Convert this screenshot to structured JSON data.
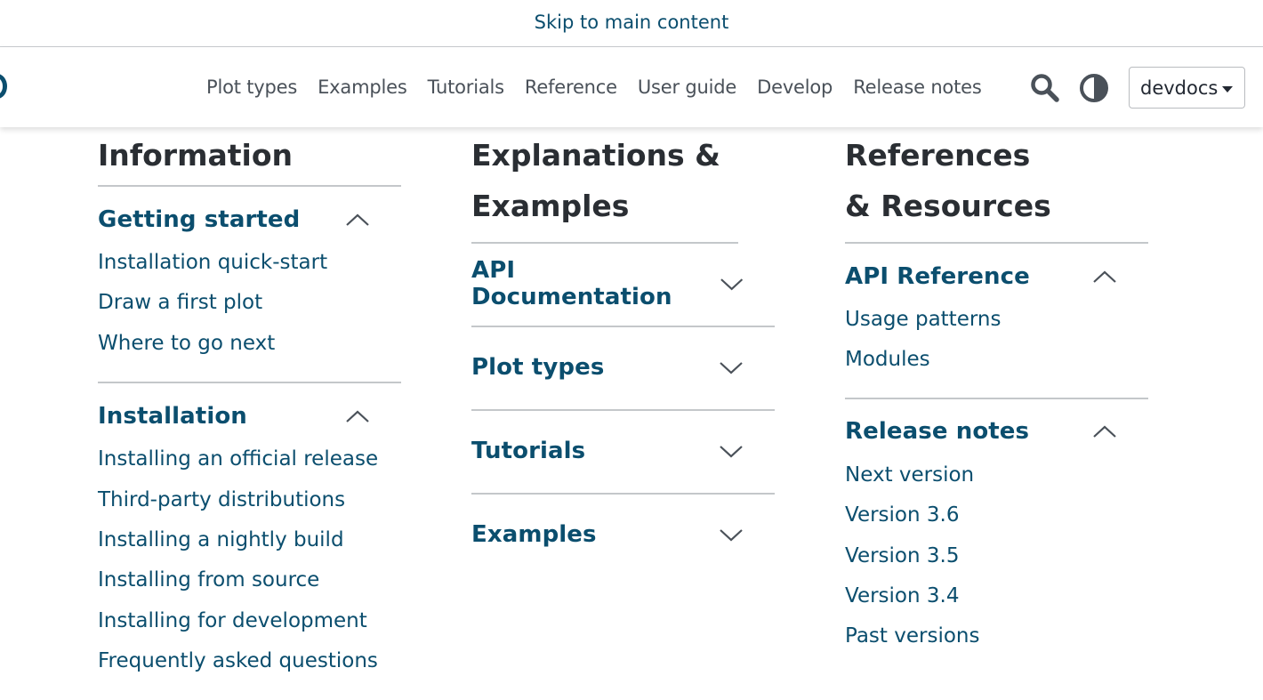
{
  "skip_link": "Skip to main content",
  "nav": {
    "links": [
      "Plot types",
      "Examples",
      "Tutorials",
      "Reference",
      "User guide",
      "Develop",
      "Release notes"
    ],
    "search_icon": "search-icon",
    "theme_icon": "theme-toggle-icon",
    "version": "devdocs"
  },
  "colors": {
    "link": "#0b4e6e",
    "heading": "#2a2e33",
    "nav": "#4a5159"
  },
  "columns": [
    {
      "title": "Information",
      "sections": [
        {
          "title": "Getting started",
          "expanded": true,
          "items": [
            "Installation quick-start",
            "Draw a first plot",
            "Where to go next"
          ]
        },
        {
          "title": "Installation",
          "expanded": true,
          "items": [
            "Installing an official release",
            "Third-party distributions",
            "Installing a nightly build",
            "Installing from source",
            "Installing for development",
            "Frequently asked questions"
          ]
        }
      ]
    },
    {
      "title": "Explanations & Examples",
      "sections": [
        {
          "title": "API Documentation",
          "expanded": false,
          "items": []
        },
        {
          "title": "Plot types",
          "expanded": false,
          "items": []
        },
        {
          "title": "Tutorials",
          "expanded": false,
          "items": []
        },
        {
          "title": "Examples",
          "expanded": false,
          "items": []
        }
      ]
    },
    {
      "title": "References & Resources",
      "sections": [
        {
          "title": "API Reference",
          "expanded": true,
          "items": [
            "Usage patterns",
            "Modules"
          ]
        },
        {
          "title": "Release notes",
          "expanded": true,
          "items": [
            "Next version",
            "Version 3.6",
            "Version 3.5",
            "Version 3.4",
            "Past versions"
          ]
        }
      ]
    }
  ]
}
